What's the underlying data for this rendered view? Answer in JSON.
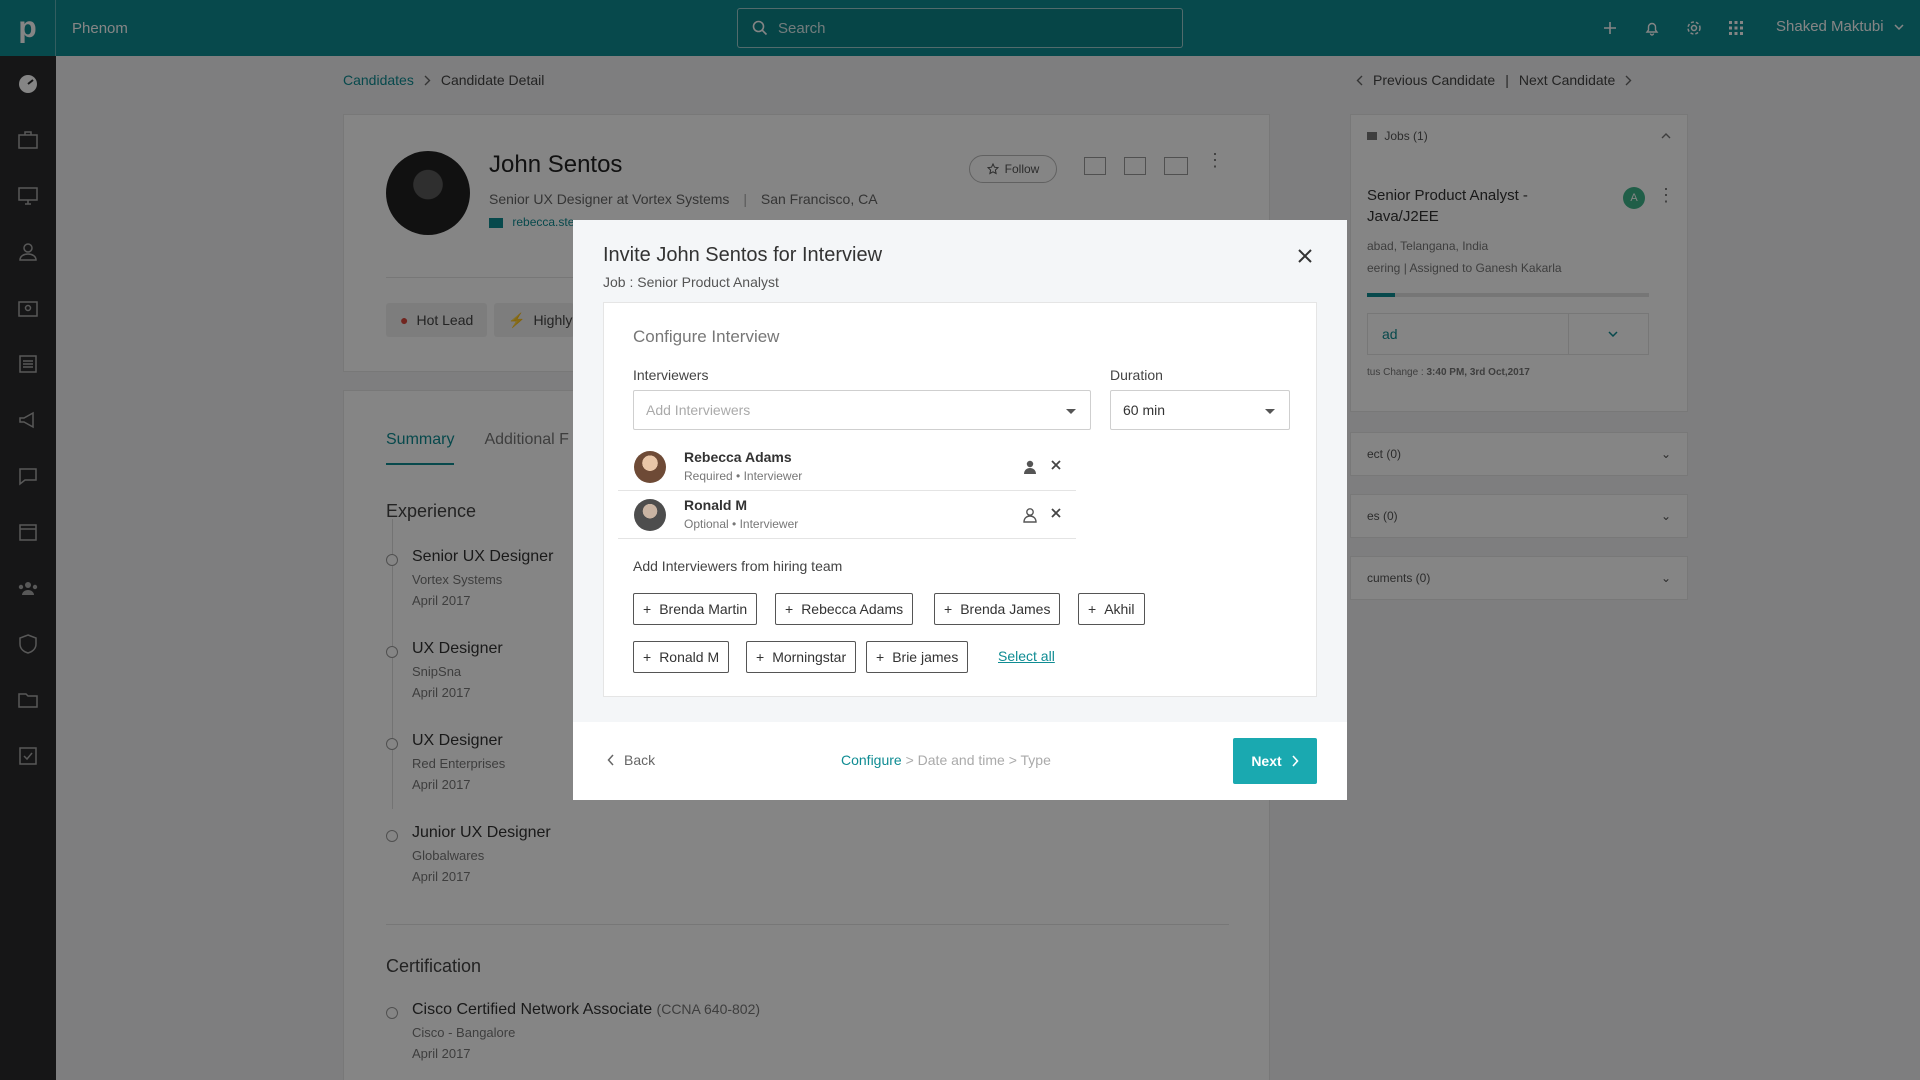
{
  "header": {
    "app_name": "Phenom",
    "search_placeholder": "Search",
    "user_name": "Shaked Maktubi"
  },
  "sidebar": {
    "items": [
      "dashboard",
      "jobs",
      "screen",
      "candidates",
      "briefcase",
      "reports",
      "campaigns",
      "messages",
      "calendar",
      "teams",
      "security",
      "folders",
      "tasks"
    ]
  },
  "breadcrumb": {
    "parent": "Candidates",
    "current": "Candidate Detail"
  },
  "navigation": {
    "previous": "Previous Candidate",
    "separator": "|",
    "next": "Next Candidate"
  },
  "profile": {
    "name": "John Sentos",
    "title": "Senior UX Designer at Vortex Systems",
    "location": "San Francisco, CA",
    "email": "rebecca.ste",
    "follow_label": "Follow",
    "tags": [
      "Hot Lead",
      "Highly"
    ]
  },
  "tabs": {
    "summary": "Summary",
    "additional": "Additional F"
  },
  "experience": {
    "title": "Experience",
    "items": [
      {
        "title": "Senior UX Designer",
        "company": "Vortex Systems",
        "date": "April 2017"
      },
      {
        "title": "UX Designer",
        "company": "SnipSna",
        "date": "April 2017"
      },
      {
        "title": "UX Designer",
        "company": "Red Enterprises",
        "date": "April 2017"
      },
      {
        "title": "Junior UX Designer",
        "company": "Globalwares",
        "date": "April 2017"
      }
    ]
  },
  "certification": {
    "title": "Certification",
    "items": [
      {
        "title": "Cisco Certified Network Associate",
        "code": "(CCNA 640-802)",
        "company": "Cisco - Bangalore",
        "date": "April 2017"
      }
    ]
  },
  "jobs_panel": {
    "header": "Jobs (1)",
    "job_title": "Senior Product Analyst - Java/J2EE",
    "location": "abad, Telangana, India",
    "department": "eering | Assigned to Ganesh Kakarla",
    "progress": 0.1,
    "status": "ad",
    "status_change_label": "tus Change : ",
    "status_change_time": "3:40 PM, 3rd Oct,2017",
    "avatar_letter": "A",
    "sections": [
      "ect (0)",
      "es (0)",
      "cuments (0)"
    ]
  },
  "modal": {
    "title": "Invite John Sentos for Interview",
    "subtitle": "Job : Senior Product Analyst",
    "config_title": "Configure Interview",
    "interviewers_label": "Interviewers",
    "interviewers_placeholder": "Add Interviewers",
    "duration_label": "Duration",
    "duration_value": "60 min",
    "interviewers": [
      {
        "name": "Rebecca Adams",
        "role": "Required • Interviewer"
      },
      {
        "name": "Ronald M",
        "role": "Optional • Interviewer"
      }
    ],
    "hiring_team_label": "Add Interviewers from hiring team",
    "hiring_team": [
      "Brenda Martin",
      "Rebecca Adams",
      "Brenda James",
      "Akhil",
      "Ronald M",
      "Morningstar",
      "Brie james"
    ],
    "select_all": "Select all",
    "back_label": "Back",
    "steps": {
      "configure": "Configure",
      "rest": " > Date and time > Type",
      "separator": ">"
    },
    "next_label": "Next"
  },
  "colors": {
    "brand": "#0f8c93",
    "button": "#1aa9b0",
    "sidebar": "#2b2b2c"
  }
}
